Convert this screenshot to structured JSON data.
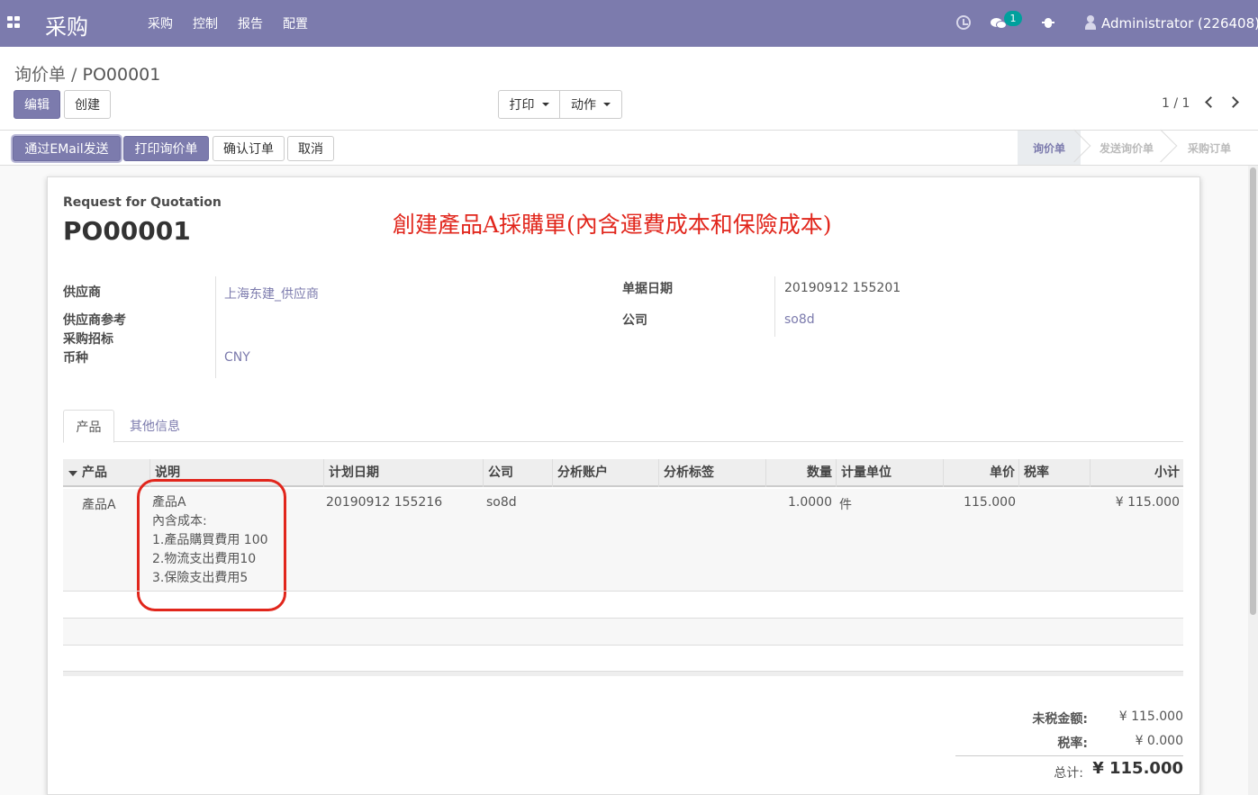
{
  "navbar": {
    "brand": "采购",
    "menu": [
      "采购",
      "控制",
      "报告",
      "配置"
    ],
    "chat_badge": "1",
    "user": "Administrator (226408)"
  },
  "breadcrumb": {
    "parent": "询价单",
    "separator": " / ",
    "current": "PO00001"
  },
  "control": {
    "edit": "编辑",
    "create": "创建",
    "print": "打印",
    "action": "动作",
    "pager": "1 / 1"
  },
  "statusbar": {
    "buttons": [
      "通过EMail发送",
      "打印询价单",
      "确认订单",
      "取消"
    ],
    "stages": [
      "询价单",
      "发送询价单",
      "采购订单"
    ],
    "active_stage": "询价单"
  },
  "doc": {
    "label": "Request for Quotation",
    "name": "PO00001",
    "annotation": "創建產品A採購單(內含運費成本和保險成本)"
  },
  "fields": {
    "vendor_label": "供应商",
    "vendor_value": "上海东建_供应商",
    "vendor_ref_label": "供应商参考",
    "tender_label": "采购招标",
    "currency_label": "币种",
    "currency_value": "CNY",
    "date_label": "单据日期",
    "date_value": "20190912 155201",
    "company_label": "公司",
    "company_value": "so8d"
  },
  "tabs": [
    "产品",
    "其他信息"
  ],
  "table": {
    "headers": [
      "产品",
      "说明",
      "计划日期",
      "公司",
      "分析账户",
      "分析标签",
      "数量",
      "计量单位",
      "单价",
      "税率",
      "小计"
    ],
    "row": {
      "product": "產品A",
      "description": [
        "產品A",
        "內含成本:",
        "1.產品購買費用 100",
        "2.物流支出費用10",
        "3.保險支出費用5"
      ],
      "date": "20190912 155216",
      "company": "so8d",
      "qty": "1.0000",
      "uom": "件",
      "price": "115.000",
      "subtotal": "¥ 115.000"
    }
  },
  "totals": {
    "untaxed_label": "未税金额:",
    "untaxed_value": "¥ 115.000",
    "tax_label": "税率:",
    "tax_value": "¥ 0.000",
    "total_label": "总计:",
    "total_value": "¥ 115.000"
  },
  "colors": {
    "brand": "#7c7bad",
    "annotation_red": "#e1261c",
    "badge": "#00a09d"
  }
}
